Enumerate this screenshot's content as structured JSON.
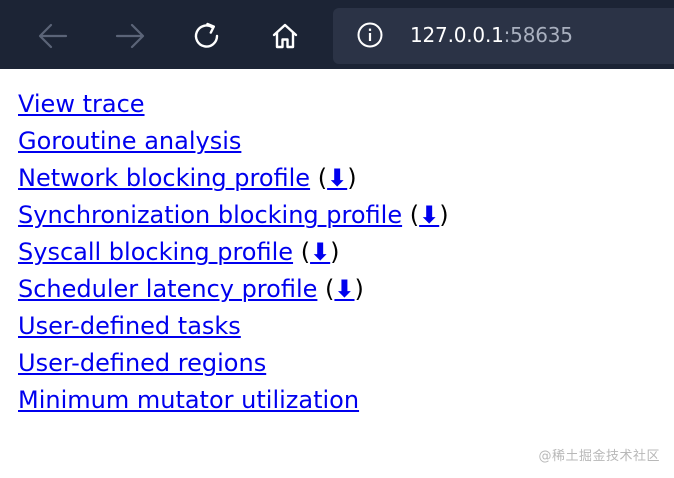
{
  "browser": {
    "url_host": "127.0.0.1",
    "url_port": ":58635",
    "back_icon": "arrow-left-icon",
    "forward_icon": "arrow-right-icon",
    "refresh_icon": "refresh-icon",
    "home_icon": "home-icon",
    "info_icon": "info-circle-icon"
  },
  "links": [
    {
      "label": "View trace",
      "download": ""
    },
    {
      "label": "Goroutine analysis",
      "download": ""
    },
    {
      "label": "Network blocking profile",
      "download": "⬇"
    },
    {
      "label": "Synchronization blocking profile",
      "download": "⬇"
    },
    {
      "label": "Syscall blocking profile",
      "download": "⬇"
    },
    {
      "label": "Scheduler latency profile",
      "download": "⬇"
    },
    {
      "label": "User-defined tasks",
      "download": ""
    },
    {
      "label": "User-defined regions",
      "download": ""
    },
    {
      "label": "Minimum mutator utilization",
      "download": ""
    }
  ],
  "watermark": "@稀土掘金技术社区",
  "colors": {
    "toolbar_bg": "#1c2435",
    "addressbar_bg": "#2b3346",
    "link": "#0000ee"
  }
}
